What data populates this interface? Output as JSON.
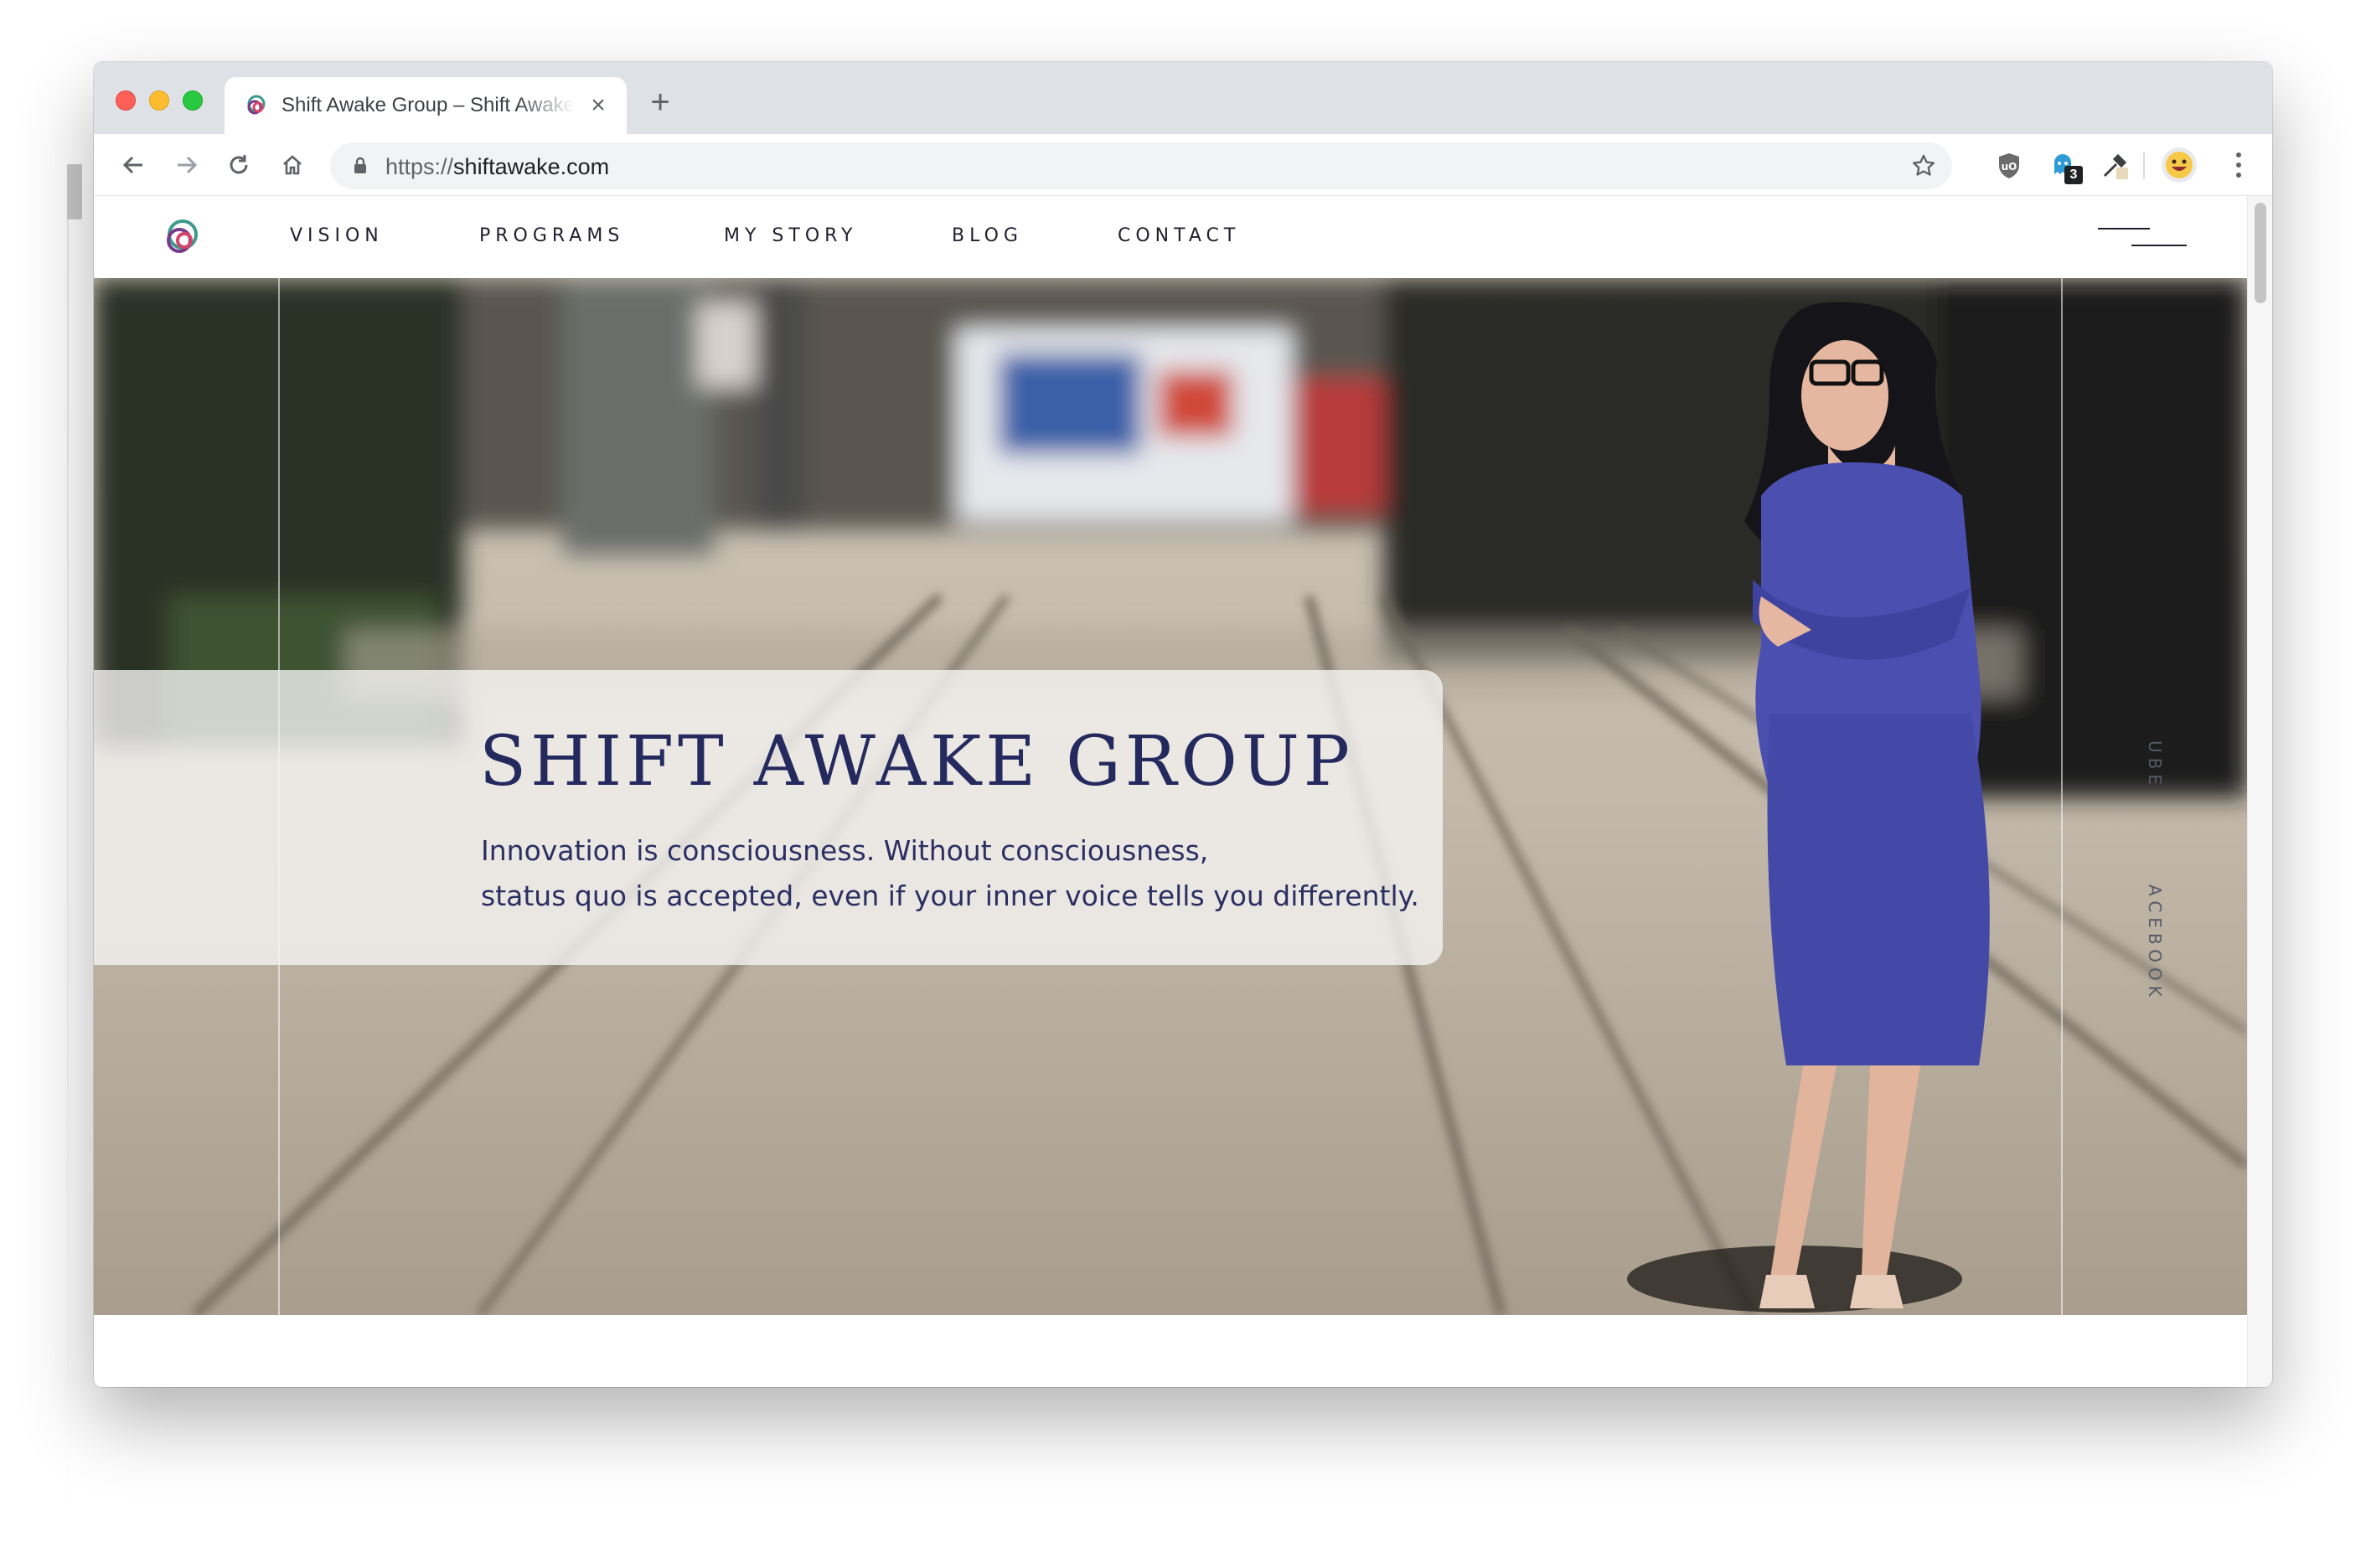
{
  "browser": {
    "tab_title": "Shift Awake Group – Shift Awake",
    "new_tab_symbol": "+",
    "close_symbol": "×",
    "url_scheme": "https://",
    "url_host": "shiftawake.com",
    "extension_badge": "3"
  },
  "site": {
    "nav": [
      "VISION",
      "PROGRAMS",
      "MY STORY",
      "BLOG",
      "CONTACT"
    ],
    "hero": {
      "title": "SHIFT AWAKE GROUP",
      "line1": "Innovation is consciousness. Without consciousness,",
      "line2": "status quo is accepted, even if your inner voice tells you differently."
    },
    "social": [
      "UBE",
      "ACEBOOK"
    ]
  },
  "colors": {
    "brand_navy": "#252a5e",
    "dress_blue": "#4b4fb0"
  }
}
